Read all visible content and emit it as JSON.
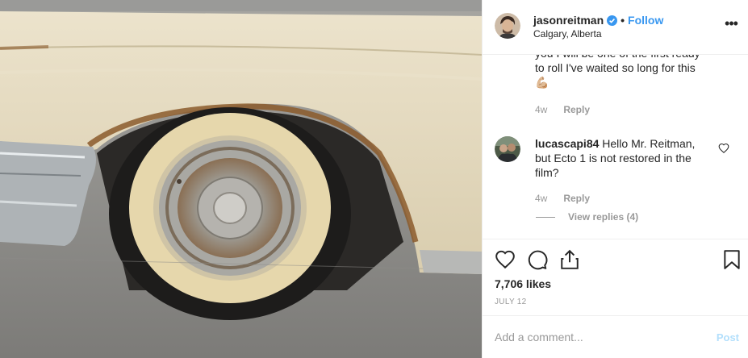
{
  "header": {
    "username": "jasonreitman",
    "separator": "•",
    "follow_label": "Follow",
    "location": "Calgary, Alberta",
    "more_icon": "ellipsis-icon"
  },
  "comments": [
    {
      "text": "you I will be one of the first ready to roll I've waited so long for this 💪🏼",
      "time": "4w",
      "reply_label": "Reply"
    },
    {
      "username": "lucascapi84",
      "text": "Hello Mr. Reitman, but Ecto 1 is not restored in the film?",
      "time": "4w",
      "reply_label": "Reply",
      "view_replies": "View replies (4)"
    }
  ],
  "actions": {
    "icons": [
      "heart-icon",
      "comment-icon",
      "share-icon",
      "bookmark-icon"
    ],
    "likes": "7,706 likes",
    "date": "JULY 12"
  },
  "add_comment": {
    "placeholder": "Add a comment...",
    "post_label": "Post"
  },
  "colors": {
    "link": "#3897f0",
    "muted": "#999999",
    "post_disabled": "#b2dffc",
    "verified": "#3897f0"
  }
}
